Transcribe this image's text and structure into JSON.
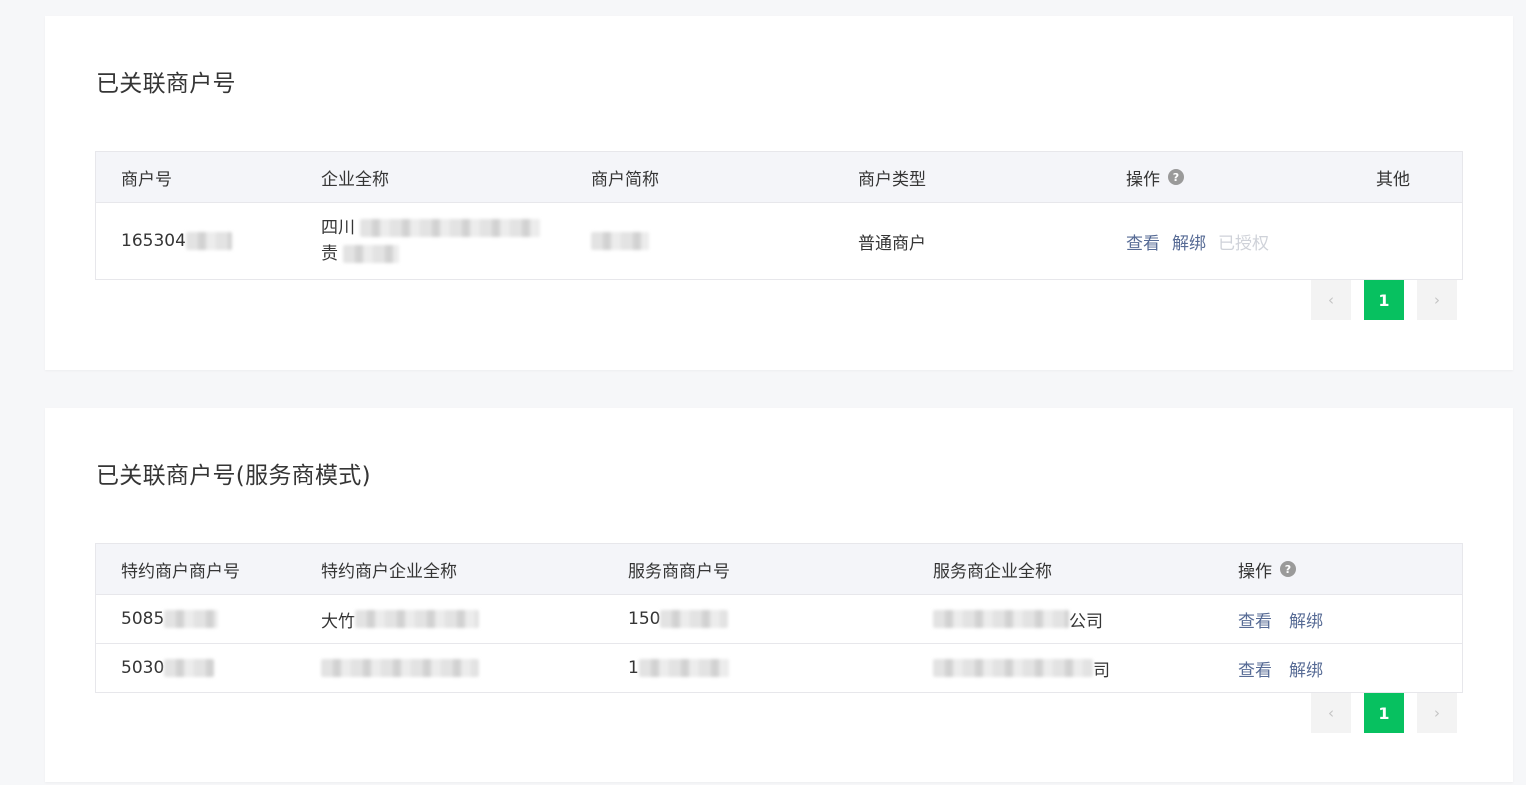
{
  "section1": {
    "title": "已关联商户号",
    "columns": [
      "商户号",
      "企业全称",
      "商户简称",
      "商户类型",
      "操作",
      "其他"
    ],
    "help_glyph": "?",
    "row": {
      "merchant_id": "165304",
      "company_line1": "四川",
      "company_line2": "责",
      "short_name": "",
      "type": "普通商户",
      "actions": {
        "view": "查看",
        "unbind": "解绑",
        "authorized": "已授权"
      },
      "other": ""
    },
    "pagination": {
      "prev": "‹",
      "current": "1",
      "next": "›"
    }
  },
  "section2": {
    "title": "已关联商户号(服务商模式)",
    "columns": [
      "特约商户商户号",
      "特约商户企业全称",
      "服务商商户号",
      "服务商企业全称",
      "操作"
    ],
    "help_glyph": "?",
    "rows": [
      {
        "sub_id": "5085",
        "sub_company": "大竹",
        "sp_id": "150",
        "sp_company": "公司",
        "view": "查看",
        "unbind": "解绑"
      },
      {
        "sub_id": "5030",
        "sub_company": "",
        "sp_id": "1",
        "sp_company": "司",
        "view": "查看",
        "unbind": "解绑"
      }
    ],
    "pagination": {
      "prev": "‹",
      "current": "1",
      "next": "›"
    }
  },
  "colors": {
    "accent": "#07c160",
    "link": "#576b95",
    "disabled_link": "#cfd2d9",
    "header_bg": "#f4f5f9",
    "page_bg": "#f6f7f9"
  }
}
